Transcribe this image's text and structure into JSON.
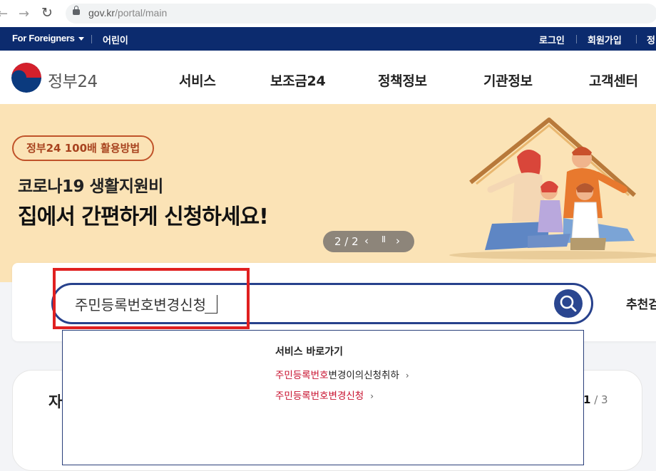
{
  "browser": {
    "url_host": "gov.kr",
    "url_path": "/portal/main",
    "back_icon": "arrow-left-icon",
    "forward_icon": "arrow-right-icon",
    "reload_icon": "reload-icon"
  },
  "utilbar": {
    "foreigners": "For Foreigners",
    "kids": "어린이",
    "login": "로그인",
    "join": "회원가입",
    "more": "정"
  },
  "header": {
    "logo_text": "정부24",
    "menu": [
      "서비스",
      "보조금24",
      "정책정보",
      "기관정보",
      "고객센터"
    ]
  },
  "banner": {
    "pill": "정부24 100배 활용방법",
    "subtitle": "코로나19 생활지원비",
    "title": "집에서 간편하게 신청하세요!",
    "pager": "2 / 2",
    "prev": "‹",
    "pause": "II",
    "next": "›"
  },
  "search": {
    "value": "주민등록번호변경신청",
    "recommend": "추천검"
  },
  "dropdown": {
    "title": "서비스 바로가기",
    "items": [
      {
        "highlight": "주민등록번호",
        "rest": "변경이의신청취하"
      },
      {
        "highlight": "주민등록번호변경신청",
        "rest": ""
      }
    ],
    "chevron": "›"
  },
  "lower": {
    "title": "자",
    "page_current": "1",
    "page_total": " / 3"
  },
  "colors": {
    "navy": "#0c2b6e",
    "banner_bg": "#fbe3b6",
    "search_border": "#27418c",
    "highlight_red": "#e02020",
    "match_red": "#c8102e"
  }
}
